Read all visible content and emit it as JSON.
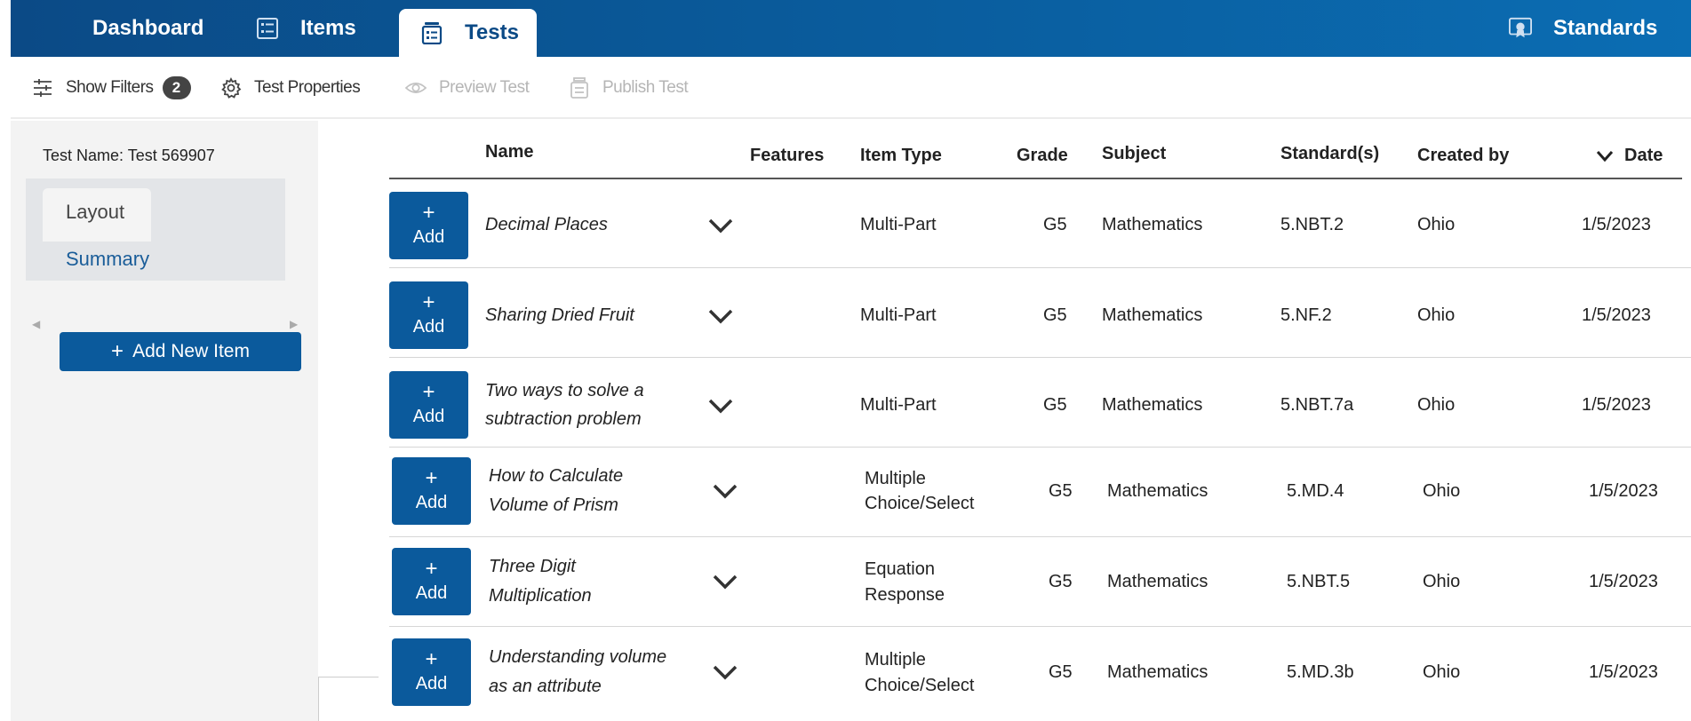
{
  "nav": {
    "dashboard": "Dashboard",
    "items": "Items",
    "tests": "Tests",
    "standards": "Standards"
  },
  "toolbar": {
    "show_filters": "Show Filters",
    "filter_count": "2",
    "test_properties": "Test Properties",
    "preview_test": "Preview Test",
    "publish_test": "Publish Test"
  },
  "sidebar": {
    "test_name": "Test Name: Test 569907",
    "tab_layout": "Layout",
    "tab_summary": "Summary",
    "add_new_item": "Add New Item"
  },
  "table": {
    "headers": {
      "name": "Name",
      "features": "Features",
      "item_type": "Item Type",
      "grade": "Grade",
      "subject": "Subject",
      "standards": "Standard(s)",
      "created_by": "Created by",
      "date": "Date"
    },
    "add_plus": "+",
    "add_label": "Add",
    "rows": [
      {
        "name1": "Decimal Places",
        "name2": "",
        "type1": "Multi-Part",
        "type2": "",
        "grade": "G5",
        "subject": "Mathematics",
        "standard": "5.NBT.2",
        "created_by": "Ohio",
        "date": "1/5/2023"
      },
      {
        "name1": "Sharing Dried Fruit",
        "name2": "",
        "type1": "Multi-Part",
        "type2": "",
        "grade": "G5",
        "subject": "Mathematics",
        "standard": "5.NF.2",
        "created_by": "Ohio",
        "date": "1/5/2023"
      },
      {
        "name1": "Two ways to solve a",
        "name2": "subtraction problem",
        "type1": "Multi-Part",
        "type2": "",
        "grade": "G5",
        "subject": "Mathematics",
        "standard": "5.NBT.7a",
        "created_by": "Ohio",
        "date": "1/5/2023"
      },
      {
        "name1": "How to Calculate",
        "name2": "Volume of Prism",
        "type1": "Multiple",
        "type2": "Choice/Select",
        "grade": "G5",
        "subject": "Mathematics",
        "standard": "5.MD.4",
        "created_by": "Ohio",
        "date": "1/5/2023"
      },
      {
        "name1": "Three Digit",
        "name2": "Multiplication",
        "type1": "Equation",
        "type2": "Response",
        "grade": "G5",
        "subject": "Mathematics",
        "standard": "5.NBT.5",
        "created_by": "Ohio",
        "date": "1/5/2023"
      },
      {
        "name1": "Understanding volume",
        "name2": "as an attribute",
        "type1": "Multiple",
        "type2": "Choice/Select",
        "grade": "G5",
        "subject": "Mathematics",
        "standard": "5.MD.3b",
        "created_by": "Ohio",
        "date": "1/5/2023"
      }
    ]
  },
  "colors": {
    "nav_dark": "#0b4a86",
    "nav_light": "#0b6db3",
    "button_blue": "#0b5a9c",
    "summary_link": "#1a5d99"
  }
}
